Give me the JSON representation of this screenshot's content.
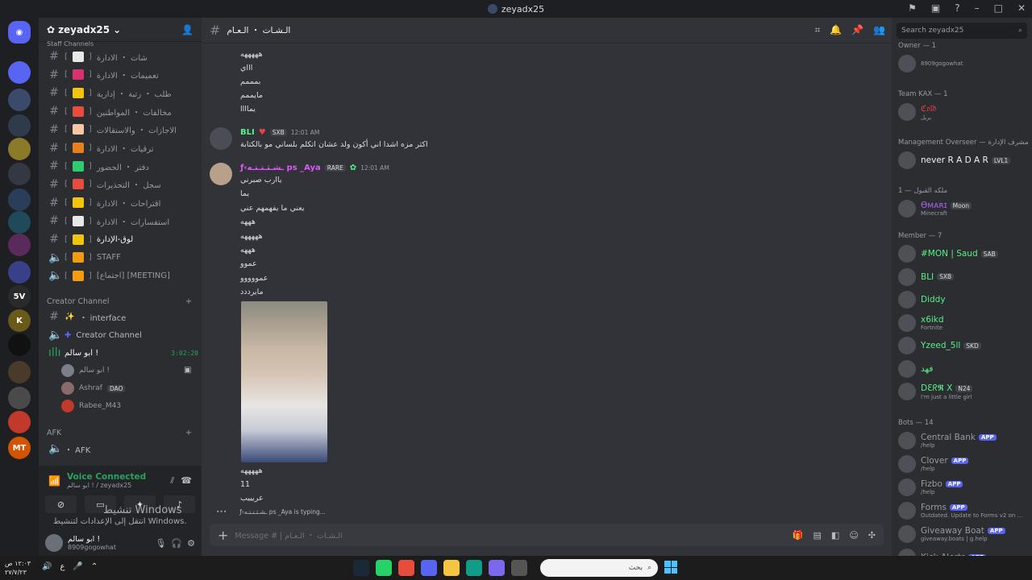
{
  "window": {
    "title": "zeyadx25",
    "controls": [
      "flag",
      "inbox",
      "help",
      "minimize",
      "maximize",
      "close"
    ]
  },
  "servers": [
    {
      "label": "",
      "color": "#5865f2",
      "badge": ""
    },
    {
      "label": "",
      "color": "#3b4a6b",
      "badge": ""
    },
    {
      "label": "",
      "color": "#2f3a4a",
      "badge": ""
    },
    {
      "label": "",
      "color": "#8b7a2a",
      "badge": ""
    },
    {
      "label": "",
      "color": "#333842",
      "badge": "1"
    },
    {
      "label": "",
      "color": "#2a3d5a",
      "badge": "764"
    },
    {
      "label": "",
      "color": "#1e4a5a",
      "badge": ""
    },
    {
      "label": "",
      "color": "#5a2a5a",
      "badge": "553"
    },
    {
      "label": "",
      "color": "#3a3f8a",
      "badge": ""
    },
    {
      "label": "5V",
      "color": "#2a2a2a",
      "badge": ""
    },
    {
      "label": "K",
      "color": "#6a5a1a",
      "badge": ""
    },
    {
      "label": "",
      "color": "#111111",
      "badge": ""
    },
    {
      "label": "",
      "color": "#4a3a2a",
      "badge": "8"
    },
    {
      "label": "",
      "color": "#4a4a4a",
      "badge": ""
    },
    {
      "label": "",
      "color": "#c0392b",
      "badge": ""
    },
    {
      "label": "MT",
      "color": "#d35400",
      "badge": "2"
    }
  ],
  "guild": {
    "name": "zeyadx25",
    "partial_category": "Staff Channels"
  },
  "channels": [
    {
      "name": "شات ・ الادارة",
      "icon": "#",
      "emoji": "#e8e8e8"
    },
    {
      "name": "تعميمات ・ الادارة",
      "icon": "#",
      "emoji": "#d6336c"
    },
    {
      "name": "طلب ・ رتبة ・ إدارية",
      "icon": "#",
      "emoji": "#f1c40f"
    },
    {
      "name": "مخالفات ・ المواطنين",
      "icon": "#",
      "emoji": "#e74c3c"
    },
    {
      "name": "الاجازات ・ والاستقالات",
      "icon": "#",
      "emoji": "#f5c6a5"
    },
    {
      "name": "ترقيات ・ الادارة",
      "icon": "#",
      "emoji": "#e67e22"
    },
    {
      "name": "دفتر ・ الحضور",
      "icon": "#",
      "emoji": "#2ecc71"
    },
    {
      "name": "سجل ・ التحذيرات",
      "icon": "#",
      "emoji": "#e74c3c"
    },
    {
      "name": "اقتراحات ・ الادارة",
      "icon": "#",
      "emoji": "#f1c40f"
    },
    {
      "name": "استفسارات ・ الادارة",
      "icon": "#",
      "emoji": "#e8e8e8"
    },
    {
      "name": "لوق-الإدارة",
      "icon": "#",
      "emoji": "#f1c40f"
    },
    {
      "name": "STAFF",
      "icon": "🔈",
      "emoji": "#f39c12"
    },
    {
      "name": "[اجتماع] [MEETING]",
      "icon": "🔈",
      "emoji": "#f39c12"
    }
  ],
  "creator": {
    "category": "Creator Channel",
    "ch1": "・ interface",
    "ch2": "Creator Channel",
    "voice_name": "ابو سالم !",
    "voice_time": "3:02:20",
    "users": [
      {
        "name": "ابو سالم !",
        "tag": ""
      },
      {
        "name": "Ashraf",
        "tag": "DAO"
      },
      {
        "name": "Rabee_M43",
        "tag": ""
      }
    ]
  },
  "afk": {
    "category": "AFK",
    "channel": "・ AFK"
  },
  "voice_panel": {
    "status": "Voice Connected",
    "detail": "ابو سالم ! / zeyadx25"
  },
  "watermark": {
    "line1": "تنشيط Windows",
    "line2": "انتقل إلى الإعدادات لتنشيط Windows."
  },
  "user": {
    "name": "ابو سالم !",
    "status": "8909gogowhat"
  },
  "chat": {
    "channel_name": "الـشـات ・ الـعـام",
    "placeholder": "Message # | الـشـات ・ الـعـام",
    "top_lines": [
      "هههههه",
      "اااي",
      "بمممم",
      "مايممم",
      "يماااا"
    ],
    "msg1": {
      "author": "BLI",
      "tag": "SXB",
      "time": "12:01 AM",
      "text": "اكثر مزه اشدا اني أكون ولد عشان اتكلم بلساني مو بالكتابة"
    },
    "msg2": {
      "author": "ƒ‹ـشـثـتـتـه ps _Aya",
      "tag": "RARE",
      "time": "12:01 AM",
      "lines": [
        "ياارب صبرني",
        "يما",
        "يعني ما يفهمهم عني",
        "هههه",
        "هههههه",
        "هههه",
        "عموو",
        "عمووووو",
        "مايرددد"
      ]
    },
    "after_lines": [
      "هههههه",
      "11",
      "عريييب"
    ],
    "typing": "ƒ‹ـشـثـتـتـه ps _Aya is typing..."
  },
  "members": {
    "search_placeholder": "Search zeyadx25",
    "groups": [
      {
        "title": "Owner — 1",
        "items": [
          {
            "name": "",
            "status": "8909gogowhat",
            "color": "#f2f3f5",
            "tag": ""
          }
        ]
      },
      {
        "title": "Team KAX — 1",
        "items": [
          {
            "name": "ℭ𝔬𝔩𝔡",
            "status": "بريل",
            "color": "#ed4245",
            "tag": ""
          }
        ]
      },
      {
        "title": "Management Overseer — مشرف الإدارة",
        "items": [
          {
            "name": "never R A D A R",
            "status": "",
            "color": "#f2f3f5",
            "tag": "LVL1"
          }
        ]
      },
      {
        "title": "ملكه القبول — 1",
        "items": [
          {
            "name": "Ѳᴍᴀʀɪ",
            "status": "Minecraft",
            "color": "#a960ee",
            "tag": "Moon"
          }
        ]
      },
      {
        "title": "Member — 7",
        "items": [
          {
            "name": "#MON | Saud",
            "status": "",
            "color": "#57f287",
            "tag": "SAB"
          },
          {
            "name": "BLI",
            "status": "",
            "color": "#57f287",
            "tag": "SXB"
          },
          {
            "name": "Diddy",
            "status": "",
            "color": "#57f287",
            "tag": ""
          },
          {
            "name": "x6ikd",
            "status": "Fortnite",
            "color": "#57f287",
            "tag": ""
          },
          {
            "name": "Yzeed_5ll",
            "status": "",
            "color": "#57f287",
            "tag": "SKD"
          },
          {
            "name": "فهد",
            "status": "",
            "color": "#57f287",
            "tag": ""
          },
          {
            "name": "DƐᖇ𝕽 X",
            "status": "I'm just a little girl",
            "color": "#57f287",
            "tag": "N24"
          }
        ]
      },
      {
        "title": "Bots — 14",
        "items": [
          {
            "name": "Central Bank",
            "status": "/help",
            "color": "#949ba4",
            "tag": "APP"
          },
          {
            "name": "Clover",
            "status": "/help",
            "color": "#949ba4",
            "tag": "APP"
          },
          {
            "name": "Fizbo",
            "status": "/help",
            "color": "#949ba4",
            "tag": "APP"
          },
          {
            "name": "Forms",
            "status": "Outdated. Update to Forms v2 on ...",
            "color": "#949ba4",
            "tag": "APP"
          },
          {
            "name": "Giveaway Boat",
            "status": "giveaway.boats | g.help",
            "color": "#949ba4",
            "tag": "APP"
          },
          {
            "name": "Kick Alerts",
            "status": "",
            "color": "#949ba4",
            "tag": "APP"
          }
        ]
      }
    ]
  },
  "taskbar": {
    "time": "١٢:٠٣ ص",
    "date": "٢٧/٧/٢٣",
    "search": "بحث"
  }
}
